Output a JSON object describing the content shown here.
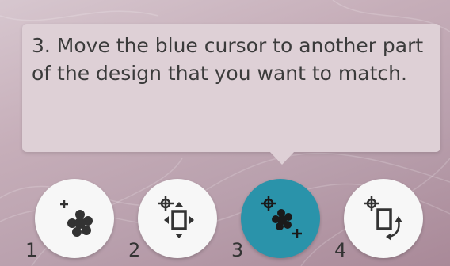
{
  "tooltip": {
    "text": "3. Move the blue cursor to another part of the design that you want to match."
  },
  "steps": [
    {
      "number": "1",
      "icon": "select-design-point-icon",
      "active": false
    },
    {
      "number": "2",
      "icon": "move-design-icon",
      "active": false
    },
    {
      "number": "3",
      "icon": "select-match-point-icon",
      "active": true
    },
    {
      "number": "4",
      "icon": "rotate-design-icon",
      "active": false
    }
  ],
  "colors": {
    "active_button": "#2a93aa",
    "button": "#f7f7f7",
    "tooltip_bg": "#ded0d6",
    "text": "#3b3b3b"
  }
}
